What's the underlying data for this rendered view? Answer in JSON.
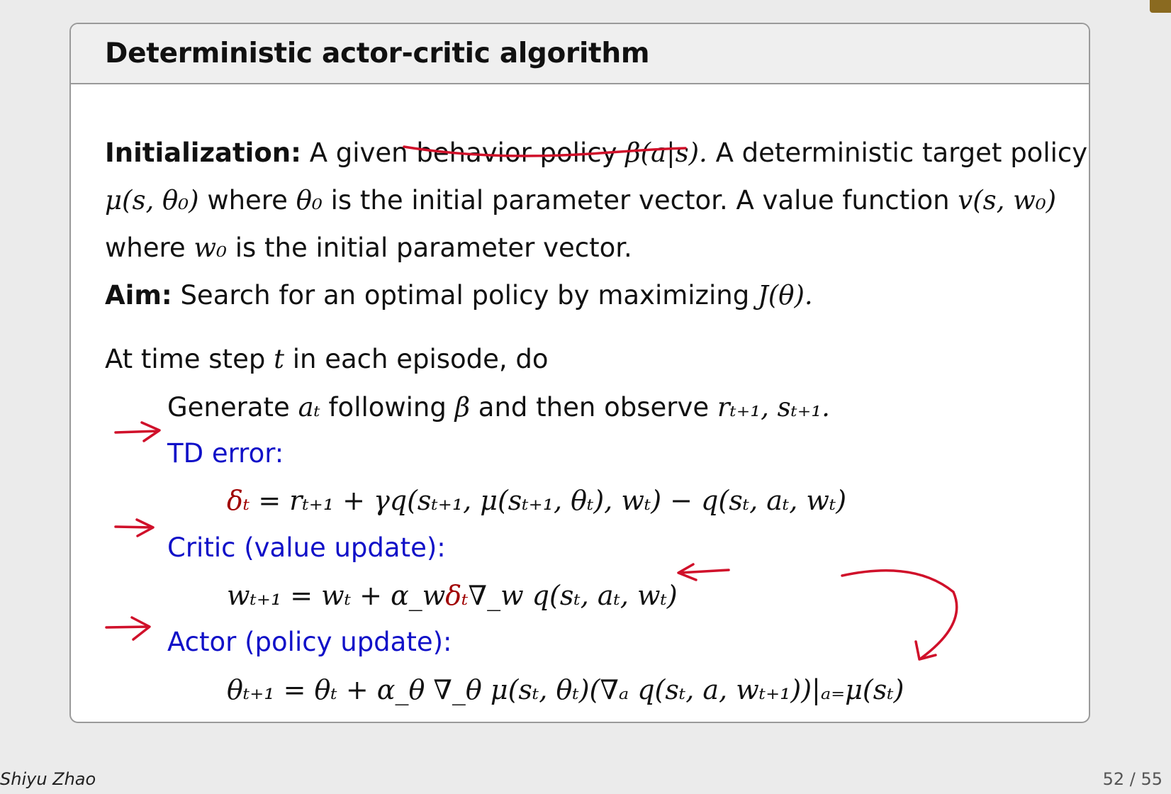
{
  "slide": {
    "title": "Deterministic actor-critic algorithm",
    "init_label": "Initialization:",
    "init_text_1": "A given behavior policy",
    "init_beta": "β(a|s).",
    "init_text_2": "A deterministic target policy",
    "mu_expr": "μ(s, θ₀)",
    "init_text_3": "where",
    "theta0": "θ₀",
    "init_text_4": "is the initial parameter vector.  A value function",
    "v_expr": "v(s, w₀)",
    "init_text_5": "where",
    "w0": "w₀",
    "init_text_6": "is the initial parameter vector.",
    "aim_label": "Aim:",
    "aim_text": "Search for an optimal policy by maximizing",
    "aim_expr": "J(θ).",
    "loop_text_1": "At time step",
    "loop_t": "t",
    "loop_text_2": "in each episode, do",
    "gen_text_1": "Generate",
    "gen_at": "aₜ",
    "gen_text_2": "following",
    "gen_beta": "β",
    "gen_text_3": "and then observe",
    "gen_obs": "rₜ₊₁, sₜ₊₁.",
    "td_label": "TD error:",
    "td_delta": "δₜ",
    "td_eq": " = rₜ₊₁ + γq(sₜ₊₁, μ(sₜ₊₁, θₜ), wₜ) − q(sₜ, aₜ, wₜ)",
    "critic_label": "Critic (value update):",
    "critic_eq_1": "wₜ₊₁ = wₜ + α_w",
    "critic_delta": "δₜ",
    "critic_eq_2": "∇_w q(sₜ, aₜ, wₜ)",
    "actor_label": "Actor (policy update):",
    "actor_eq": "θₜ₊₁ = θₜ + α_θ ∇_θ μ(sₜ, θₜ)(∇ₐ q(sₜ, a, wₜ₊₁))|ₐ₌μ(sₜ)"
  },
  "footer": {
    "author": "Shiyu Zhao",
    "page": "52 / 55"
  },
  "colors": {
    "blue": "#1010c8",
    "red": "#a00000",
    "annotation": "#d0102a"
  }
}
